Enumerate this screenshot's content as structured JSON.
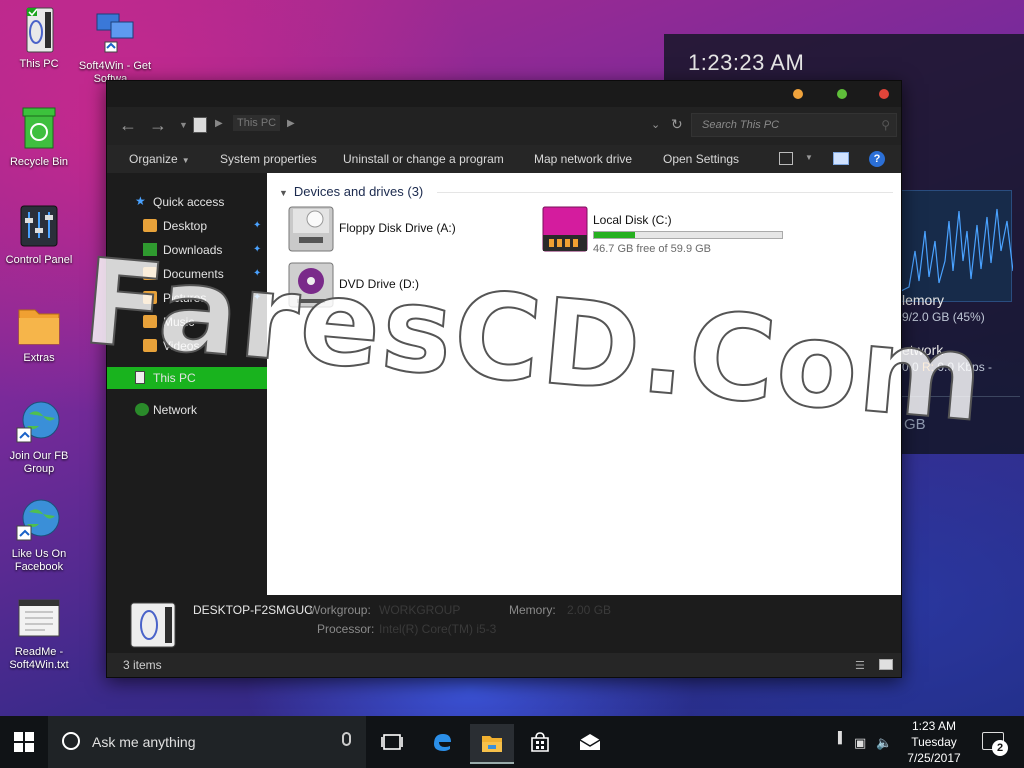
{
  "desktop": {
    "icons": [
      {
        "label": "This PC",
        "icon": "computer-icon"
      },
      {
        "label": "Soft4Win - Get Softwa...",
        "icon": "network-computers-icon"
      },
      {
        "label": "Recycle Bin",
        "icon": "recycle-bin-icon"
      },
      {
        "label": "Control Panel",
        "icon": "control-panel-icon"
      },
      {
        "label": "Extras",
        "icon": "folder-icon"
      },
      {
        "label": "Join Our FB Group",
        "icon": "globe-shortcut-icon"
      },
      {
        "label": "Like Us On Facebook",
        "icon": "globe-shortcut-icon"
      },
      {
        "label": "ReadMe - Soft4Win.txt",
        "icon": "text-file-icon"
      }
    ]
  },
  "widget": {
    "clock": "1:23:23 AM",
    "memory_title": "lemory",
    "memory_value": "9/2.0 GB (45%)",
    "network_title": "etwork",
    "network_value_prefix": "0.0 ",
    "network_r_label": "R:",
    "network_value_suffix": " 0.0 Kbps -",
    "disk_value": "GB",
    "accent_color": "#4aa2ff"
  },
  "window": {
    "address": {
      "crumb": "This PC"
    },
    "search": {
      "placeholder": "Search This PC"
    },
    "commands": {
      "organize": "Organize",
      "system_properties": "System properties",
      "uninstall": "Uninstall or change a program",
      "map_drive": "Map network drive",
      "open_settings": "Open Settings",
      "help": "?"
    },
    "sidebar": {
      "quick_access": "Quick access",
      "desktop": "Desktop",
      "downloads": "Downloads",
      "documents": "Documents",
      "pictures": "Pictures",
      "music": "Music",
      "videos": "Videos",
      "this_pc": "This PC",
      "network": "Network"
    },
    "content": {
      "group_title": "Devices and drives",
      "group_count": "(3)",
      "floppy": "Floppy Disk Drive (A:)",
      "local_disk": "Local Disk (C:)",
      "local_disk_free": "46.7 GB free of 59.9 GB",
      "local_disk_used_fraction": 0.22,
      "dvd": "DVD Drive (D:)",
      "bar_color": "#26b020"
    },
    "details": {
      "computer_name": "DESKTOP-F2SMGUC",
      "workgroup_label": "Workgroup:",
      "workgroup_value": "WORKGROUP",
      "memory_label": "Memory:",
      "memory_value": "2.00 GB",
      "processor_label": "Processor:",
      "processor_value": "Intel(R) Core(TM) i5-3"
    },
    "status": {
      "items": "3 items"
    },
    "selected_color": "#19b31e"
  },
  "watermark": "FaresCD.Com",
  "taskbar": {
    "search_prompt": "Ask me anything",
    "time": "1:23 AM",
    "day": "Tuesday",
    "date": "7/25/2017",
    "notification_count": "2"
  }
}
